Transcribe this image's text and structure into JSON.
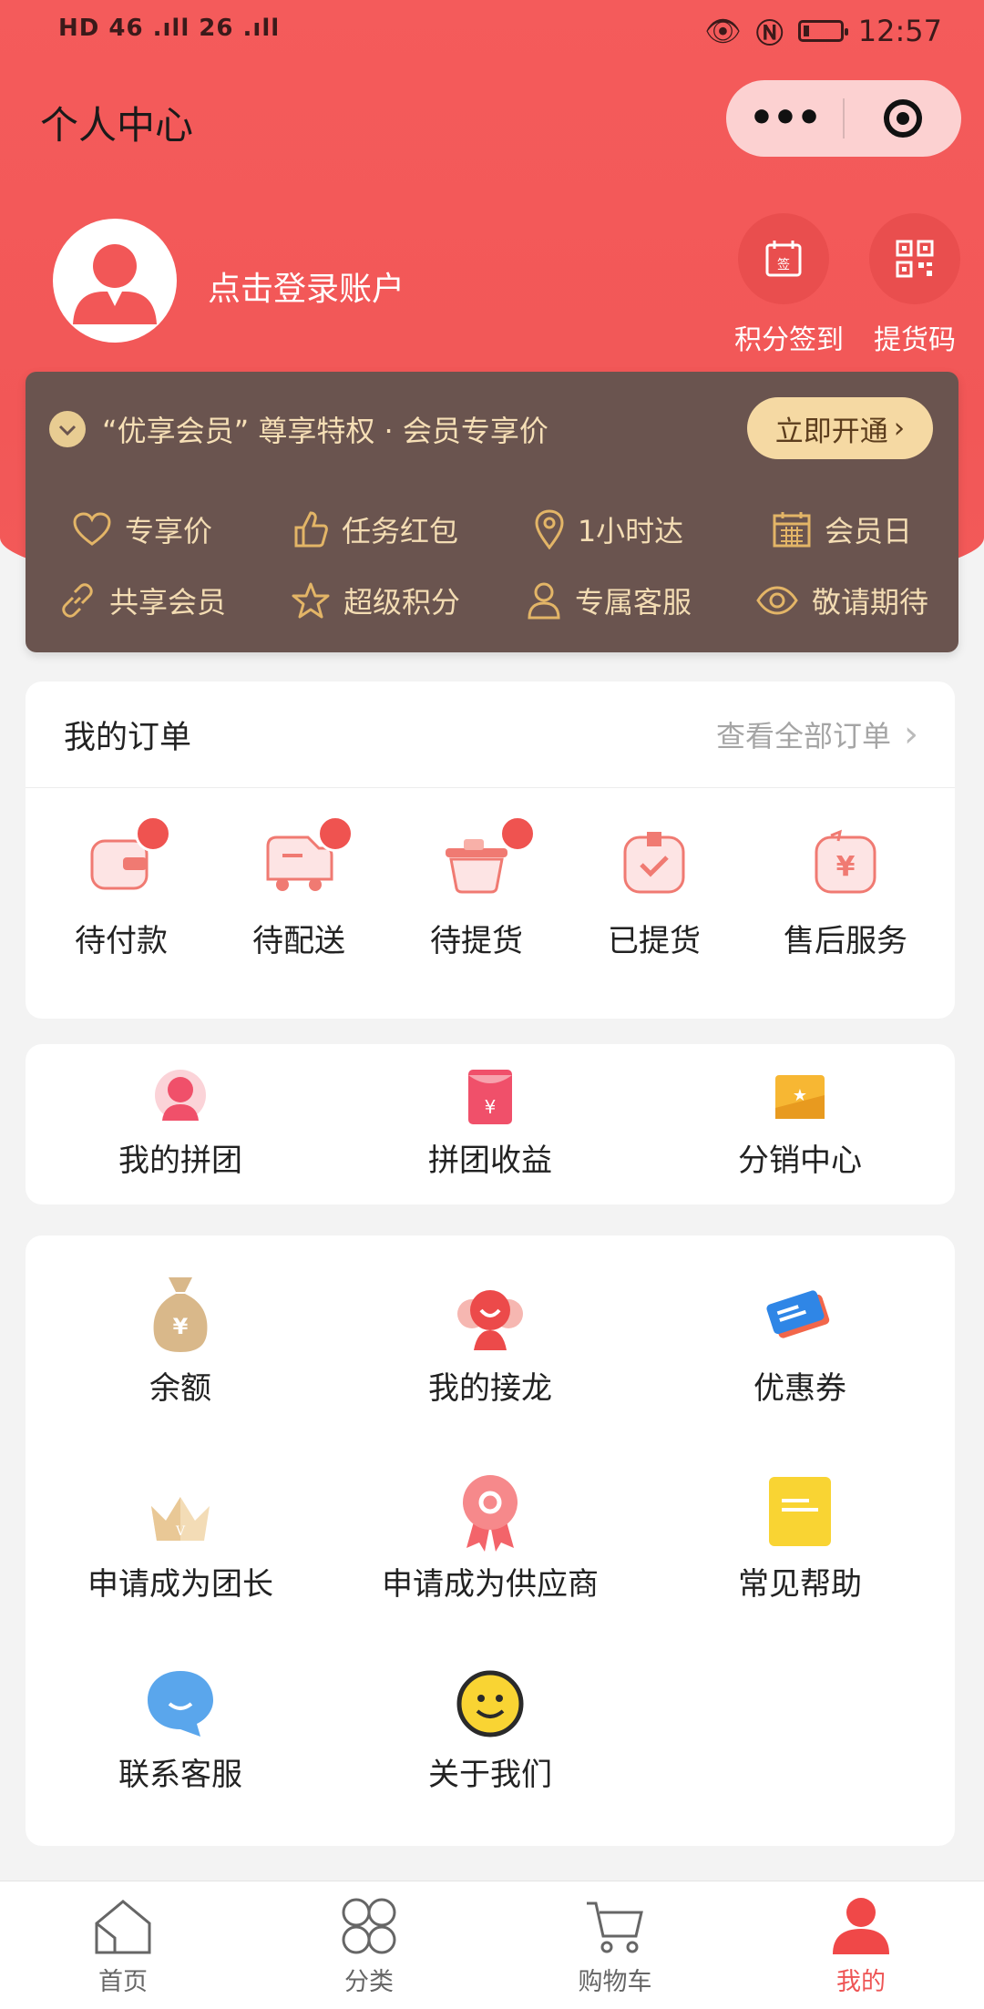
{
  "status_bar": {
    "left": "HD 46 .ıll 26 .ıll",
    "time": "12:57",
    "battery_level": 0.15
  },
  "header": {
    "title": "个人中心"
  },
  "user": {
    "login_text": "点击登录账户"
  },
  "quick_actions": [
    {
      "label": "积分签到",
      "icon": "calendar-sign-icon"
    },
    {
      "label": "提货码",
      "icon": "qr-code-icon"
    }
  ],
  "member": {
    "title": "“优享会员” 尊享特权 · 会员专享价",
    "button_label": "立即开通",
    "perks": [
      {
        "label": "专享价",
        "icon": "heart-icon"
      },
      {
        "label": "任务红包",
        "icon": "thumbs-up-icon"
      },
      {
        "label": "1小时达",
        "icon": "location-pin-icon"
      },
      {
        "label": "会员日",
        "icon": "calendar-icon"
      },
      {
        "label": "共享会员",
        "icon": "link-icon"
      },
      {
        "label": "超级积分",
        "icon": "star-icon"
      },
      {
        "label": "专属客服",
        "icon": "service-person-icon"
      },
      {
        "label": "敬请期待",
        "icon": "eye-icon"
      }
    ]
  },
  "orders": {
    "title": "我的订单",
    "view_all": "查看全部订单",
    "items": [
      {
        "label": "待付款",
        "icon": "wallet-icon",
        "badge": true
      },
      {
        "label": "待配送",
        "icon": "delivery-truck-icon",
        "badge": true
      },
      {
        "label": "待提货",
        "icon": "basket-icon",
        "badge": true
      },
      {
        "label": "已提货",
        "icon": "received-box-icon",
        "badge": false
      },
      {
        "label": "售后服务",
        "icon": "refund-yen-icon",
        "badge": false
      }
    ]
  },
  "group": {
    "items": [
      {
        "label": "我的拼团",
        "icon": "group-buy-avatar-icon"
      },
      {
        "label": "拼团收益",
        "icon": "red-envelope-icon"
      },
      {
        "label": "分销中心",
        "icon": "distribution-card-icon"
      }
    ]
  },
  "services": {
    "items": [
      {
        "label": "余额",
        "icon": "money-bag-icon"
      },
      {
        "label": "我的接龙",
        "icon": "solitaire-icon"
      },
      {
        "label": "优惠券",
        "icon": "coupon-icon"
      },
      {
        "label": "申请成为团长",
        "icon": "crown-icon"
      },
      {
        "label": "申请成为供应商",
        "icon": "ribbon-badge-icon"
      },
      {
        "label": "常见帮助",
        "icon": "help-note-icon"
      },
      {
        "label": "联系客服",
        "icon": "chat-bubble-icon"
      },
      {
        "label": "关于我们",
        "icon": "smiley-icon"
      }
    ]
  },
  "tabbar": [
    {
      "label": "首页",
      "icon": "home-icon",
      "active": false
    },
    {
      "label": "分类",
      "icon": "category-icon",
      "active": false
    },
    {
      "label": "购物车",
      "icon": "cart-icon",
      "active": false
    },
    {
      "label": "我的",
      "icon": "profile-icon",
      "active": true
    }
  ],
  "colors": {
    "primary": "#f25757",
    "member_bg": "#6a544f",
    "gold": "#f5d9a3",
    "accent_red": "#ef5350"
  }
}
